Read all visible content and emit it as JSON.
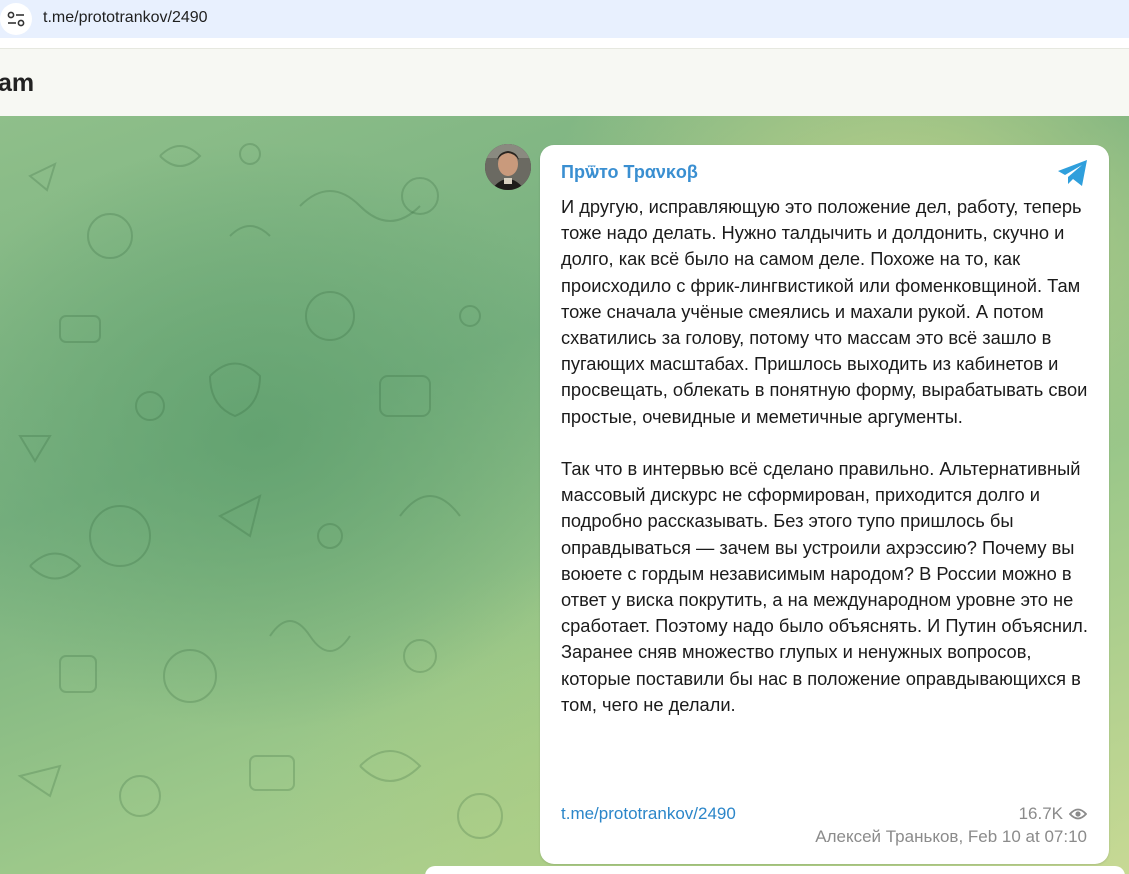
{
  "browser": {
    "url": "t.me/prototrankov/2490"
  },
  "header": {
    "title": "am"
  },
  "post": {
    "author": "Прѿто Трανκoβ",
    "paragraphs": [
      "И другую, исправляющую это положение дел, работу, теперь тоже надо делать. Нужно талдычить и долдонить, скучно и долго, как всё было на самом деле. Похоже на то, как происходило с фрик-лингвистикой или фоменковщиной. Там тоже сначала учёные смеялись и махали рукой. А потом схватились за голову, потому что массам это всё зашло в пугающих масштабах. Пришлось выходить из кабинетов и просвещать, облекать в понятную форму, вырабатывать свои простые, очевидные и меметичные аргументы.",
      "Так что в интервью всё сделано правильно. Альтернативный массовый дискурс не сформирован, приходится долго и подробно рассказывать. Без этого тупо пришлось бы оправдываться — зачем вы устроили ахрэссию? Почему вы воюете с гордым независимым народом? В России можно в ответ у виска покрутить, а на международном уровне это не сработает. Поэтому надо было объяснять. И Путин объяснил. Заранее сняв множество глупых и ненужных вопросов, которые поставили бы нас в положение оправдывающихся в том, чего не делали."
    ],
    "link": "t.me/prototrankov/2490",
    "views": "16.7K",
    "meta": "Алексей Траньков, Feb 10 at 07:10"
  },
  "colors": {
    "link": "#2b86c9",
    "author": "#3a8fd1",
    "telegram": "#2f9fdc"
  }
}
